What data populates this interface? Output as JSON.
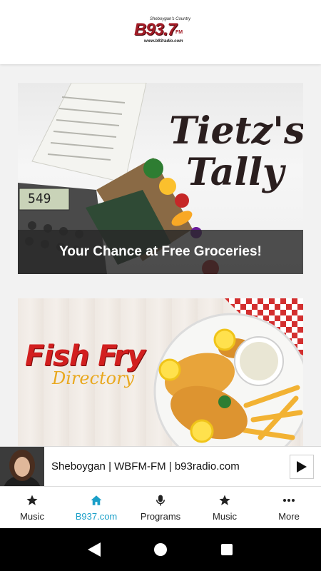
{
  "header": {
    "logo": {
      "top_text": "Sheboygan's Country",
      "main_text": "B93.7",
      "fm_text": "FM",
      "url_text": "www.b93radio.com"
    }
  },
  "cards": [
    {
      "title_line1": "Tietz's",
      "title_line2": "Tally",
      "caption": "Your Chance at Free Groceries!",
      "register_display": "549"
    },
    {
      "title": "Fish Fry",
      "subtitle": "Directory"
    }
  ],
  "player": {
    "title": "Sheboygan | WBFM-FM | b93radio.com",
    "play_icon": "play-icon"
  },
  "tabs": [
    {
      "label": "Music",
      "icon": "star-icon",
      "active": false
    },
    {
      "label": "B937.com",
      "icon": "home-icon",
      "active": true
    },
    {
      "label": "Programs",
      "icon": "microphone-icon",
      "active": false
    },
    {
      "label": "Music",
      "icon": "star-icon",
      "active": false
    },
    {
      "label": "More",
      "icon": "more-dots-icon",
      "active": false
    }
  ],
  "colors": {
    "accent": "#1a9fc8",
    "brand_red": "#a31c26",
    "tab_text": "#222222"
  }
}
